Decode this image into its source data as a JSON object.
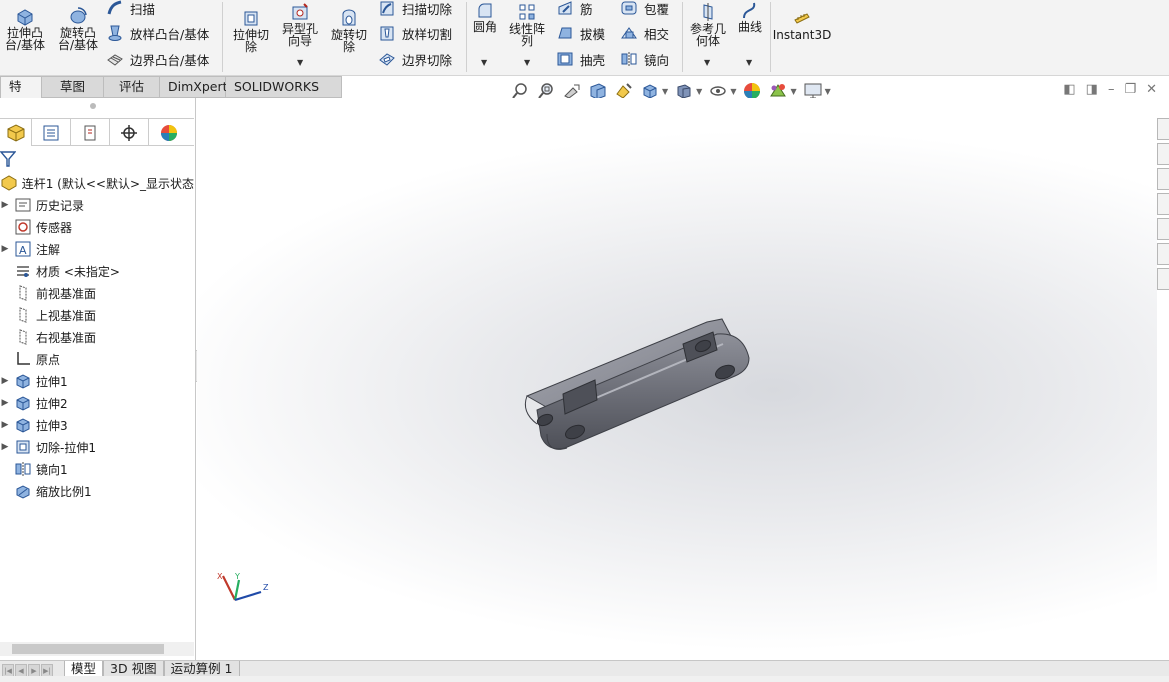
{
  "ribbon": {
    "extrude_boss": "拉伸凸\n台/基体",
    "revolve_boss": "旋转凸\n台/基体",
    "sweep": "扫描",
    "loft_boss": "放样凸台/基体",
    "boundary_boss": "边界凸台/基体",
    "extrude_cut": "拉伸切\n除",
    "hole_wizard": "异型孔\n向导",
    "revolve_cut": "旋转切\n除",
    "swept_cut": "扫描切除",
    "lofted_cut": "放样切割",
    "boundary_cut": "边界切除",
    "fillet": "圆角",
    "linear_pattern": "线性阵\n列",
    "rib": "筋",
    "draft": "拔模",
    "shell": "抽壳",
    "wrap": "包覆",
    "intersect": "相交",
    "mirror": "镜向",
    "ref_geometry": "参考几\n何体",
    "curves": "曲线",
    "instant3d": "Instant3D"
  },
  "tabs": [
    "特征",
    "草图",
    "评估",
    "DimXpert",
    "SOLIDWORKS 插件"
  ],
  "tree": {
    "root": "连杆1 (默认<<默认>_显示状态",
    "items": [
      {
        "label": "历史记录",
        "icon": "history-icon",
        "expand": true
      },
      {
        "label": "传感器",
        "icon": "sensor-icon",
        "expand": false
      },
      {
        "label": "注解",
        "icon": "annotation-icon",
        "expand": true
      },
      {
        "label": "材质 <未指定>",
        "icon": "material-icon",
        "expand": false
      },
      {
        "label": "前视基准面",
        "icon": "plane-icon",
        "expand": false
      },
      {
        "label": "上视基准面",
        "icon": "plane-icon",
        "expand": false
      },
      {
        "label": "右视基准面",
        "icon": "plane-icon",
        "expand": false
      },
      {
        "label": "原点",
        "icon": "origin-icon",
        "expand": false
      },
      {
        "label": "拉伸1",
        "icon": "extrude-icon",
        "expand": true
      },
      {
        "label": "拉伸2",
        "icon": "extrude-icon",
        "expand": true
      },
      {
        "label": "拉伸3",
        "icon": "extrude-icon",
        "expand": true
      },
      {
        "label": "切除-拉伸1",
        "icon": "cut-extrude-icon",
        "expand": true
      },
      {
        "label": "镜向1",
        "icon": "mirror-icon",
        "expand": false
      },
      {
        "label": "缩放比例1",
        "icon": "scale-icon",
        "expand": false
      }
    ]
  },
  "bottom_tabs": [
    "模型",
    "3D 视图",
    "运动算例 1"
  ],
  "triad": {
    "x": "X",
    "y": "Y",
    "z": "Z"
  },
  "colors": {
    "accent_blue": "#1f4aa8",
    "model_gray": "#6d6f78"
  }
}
